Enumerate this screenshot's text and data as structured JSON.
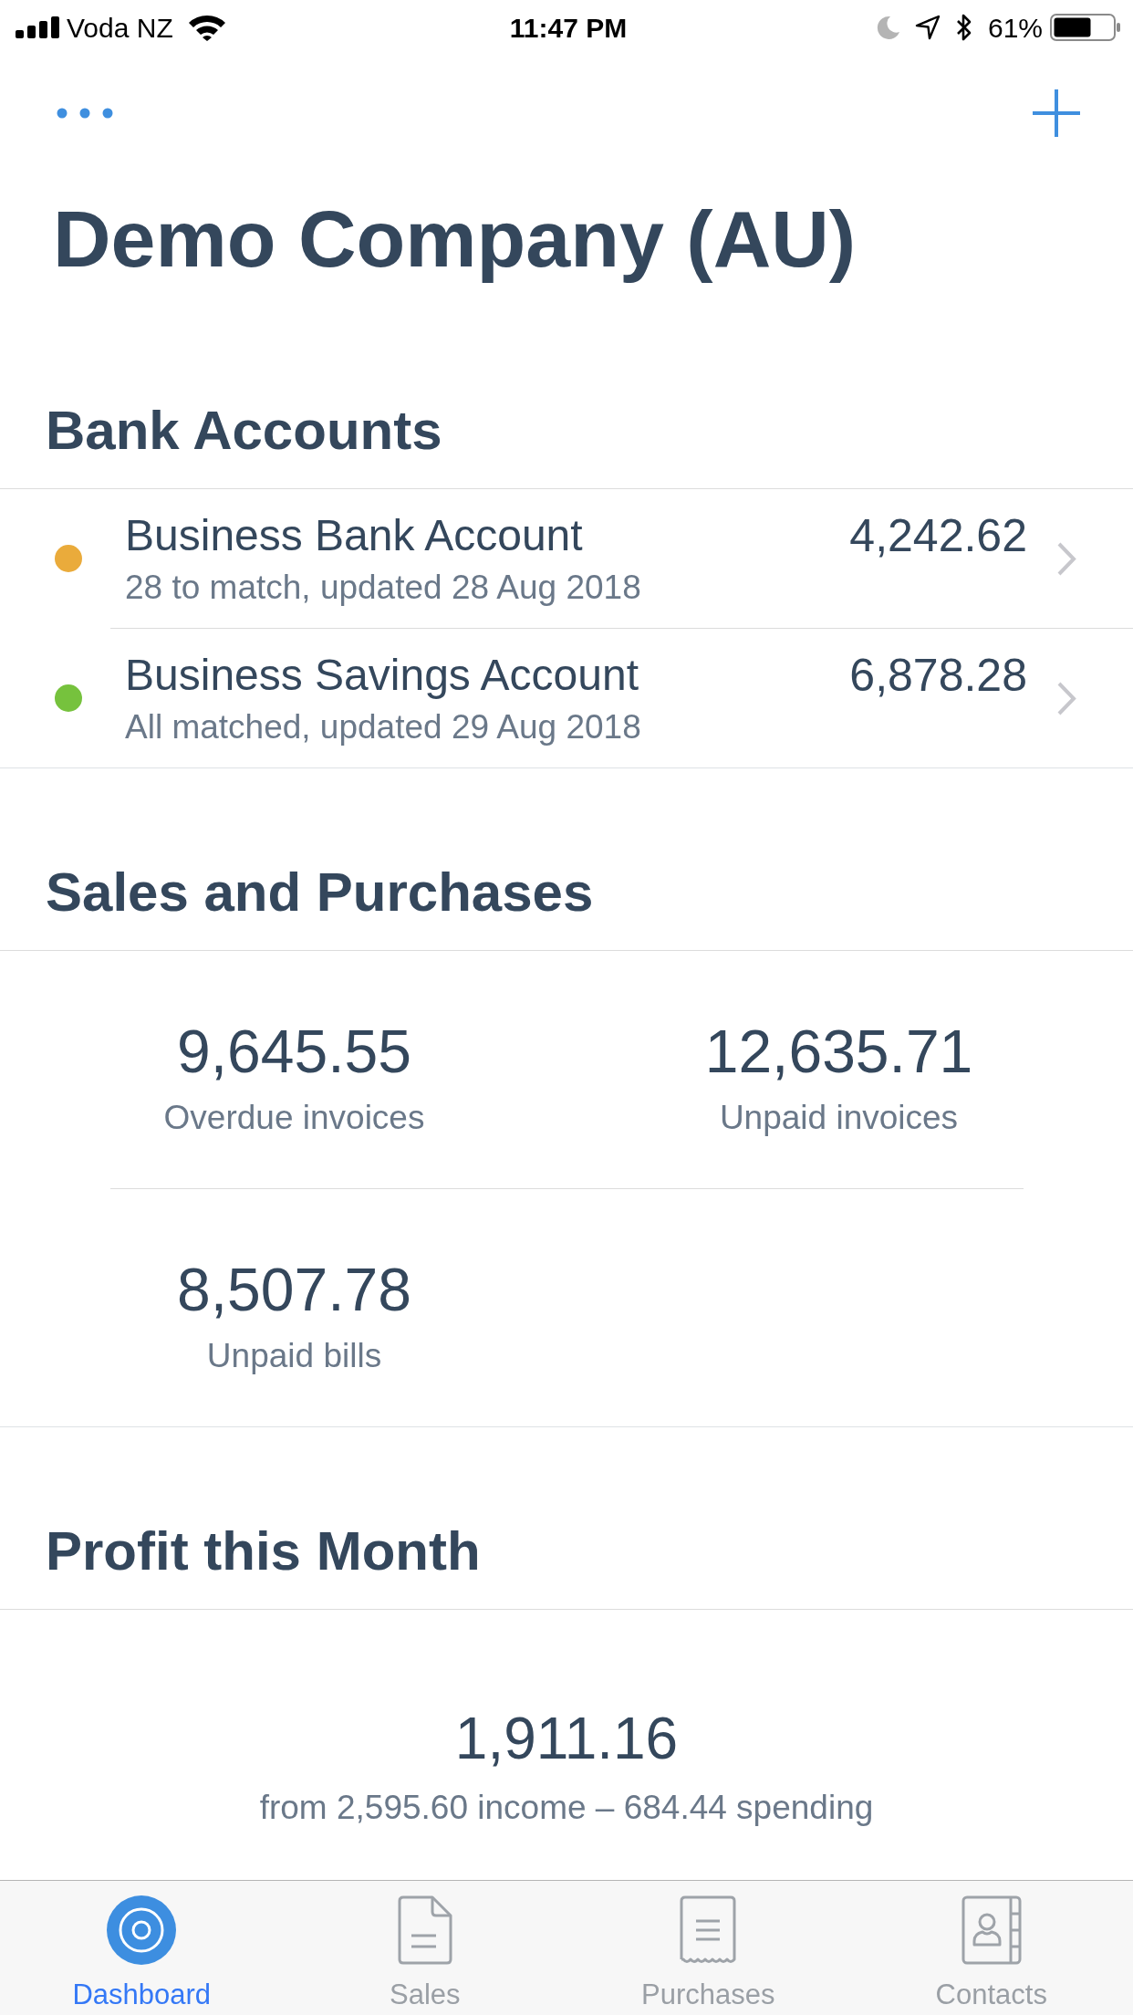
{
  "status_bar": {
    "carrier": "Voda NZ",
    "time": "11:47 PM",
    "battery": "61%"
  },
  "title": "Demo Company (AU)",
  "bank_accounts": {
    "heading": "Bank Accounts",
    "accounts": [
      {
        "name": "Business Bank Account",
        "status": "28 to match, updated 28 Aug 2018",
        "amount": "4,242.62",
        "color": "#eaab3b"
      },
      {
        "name": "Business Savings Account",
        "status": "All matched, updated 29 Aug 2018",
        "amount": "6,878.28",
        "color": "#76c23d"
      }
    ]
  },
  "sales_and_purchases": {
    "heading": "Sales and Purchases",
    "stats": [
      {
        "value": "9,645.55",
        "label": "Overdue invoices"
      },
      {
        "value": "12,635.71",
        "label": "Unpaid invoices"
      },
      {
        "value": "8,507.78",
        "label": "Unpaid bills"
      }
    ]
  },
  "profit_this_month": {
    "heading": "Profit this Month",
    "value": "1,911.16",
    "detail": "from 2,595.60 income – 684.44 spending"
  },
  "tab_bar": [
    {
      "label": "Dashboard",
      "selected": true
    },
    {
      "label": "Sales",
      "selected": false
    },
    {
      "label": "Purchases",
      "selected": false
    },
    {
      "label": "Contacts",
      "selected": false
    }
  ]
}
